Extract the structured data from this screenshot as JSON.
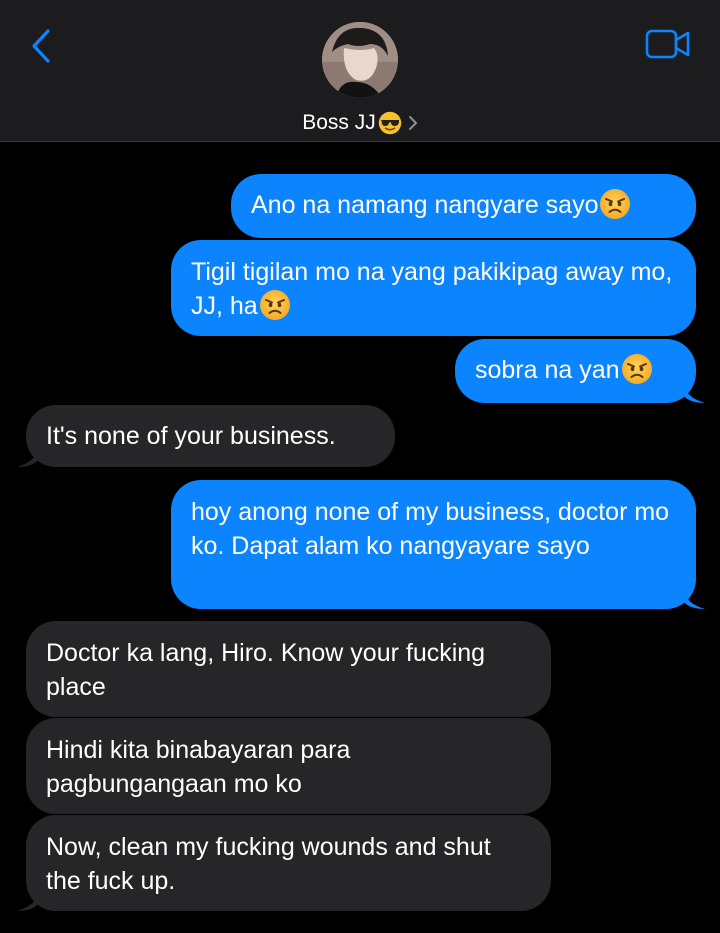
{
  "header": {
    "contact_name": "Boss JJ",
    "contact_emoji": "smiling-face-with-sunglasses",
    "back_icon": "chevron-left-icon",
    "video_icon": "video-camera-icon",
    "accent_color": "#0b84fe"
  },
  "messages": [
    {
      "from": "me",
      "text": "Ano na namang nangyare sayo",
      "emoji": "angry-face"
    },
    {
      "from": "me",
      "text": "Tigil tigilan mo na yang pakikipag away mo, JJ, ha",
      "emoji": "angry-face"
    },
    {
      "from": "me",
      "text": "sobra na yan",
      "emoji": "angry-face"
    },
    {
      "from": "them",
      "text": "It's none of your business."
    },
    {
      "from": "me",
      "text": "hoy anong none of my business, doctor mo ko. Dapat alam ko nangyayare sayo"
    },
    {
      "from": "them",
      "text": "Doctor ka lang, Hiro. Know your fucking place"
    },
    {
      "from": "them",
      "text": "Hindi kita binabayaran para pagbungangaan mo ko"
    },
    {
      "from": "them",
      "text": "Now, clean my fucking wounds and shut the fuck up."
    }
  ],
  "colors": {
    "sent_bubble": "#0b84fe",
    "received_bubble": "#262628",
    "background": "#000000",
    "header_background": "#1c1c1e"
  }
}
